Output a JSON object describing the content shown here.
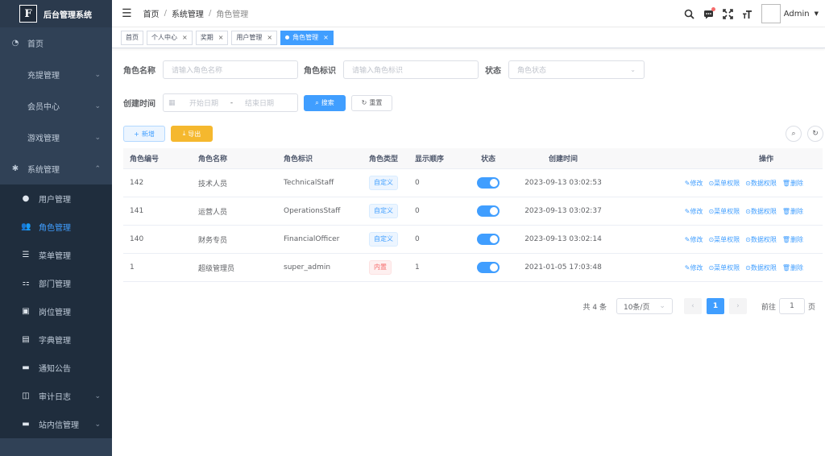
{
  "app": {
    "logo_letter": "F",
    "title": "后台管理系统"
  },
  "sidebar": {
    "items": [
      {
        "label": "首页",
        "icon": "dashboard-icon"
      },
      {
        "label": "充提管理"
      },
      {
        "label": "会员中心"
      },
      {
        "label": "游戏管理"
      },
      {
        "label": "系统管理",
        "icon": "gear-icon"
      }
    ],
    "submenu": [
      {
        "label": "用户管理",
        "icon": "user-icon"
      },
      {
        "label": "角色管理",
        "icon": "peoples-icon"
      },
      {
        "label": "菜单管理",
        "icon": "menu-list-icon"
      },
      {
        "label": "部门管理",
        "icon": "tree-icon"
      },
      {
        "label": "岗位管理",
        "icon": "post-icon"
      },
      {
        "label": "字典管理",
        "icon": "dict-icon"
      },
      {
        "label": "通知公告",
        "icon": "message-icon"
      },
      {
        "label": "审计日志",
        "icon": "log-icon"
      },
      {
        "label": "站内信管理",
        "icon": "mail-icon"
      }
    ]
  },
  "header": {
    "breadcrumb": [
      "首页",
      "系统管理",
      "角色管理"
    ],
    "user": "Admin"
  },
  "tags": [
    {
      "label": "首页"
    },
    {
      "label": "个人中心"
    },
    {
      "label": "奖期"
    },
    {
      "label": "用户管理"
    },
    {
      "label": "角色管理"
    }
  ],
  "search": {
    "role_name_label": "角色名称",
    "role_name_placeholder": "请输入角色名称",
    "role_key_label": "角色标识",
    "role_key_placeholder": "请输入角色标识",
    "status_label": "状态",
    "status_placeholder": "角色状态",
    "created_label": "创建时间",
    "start_placeholder": "开始日期",
    "range_sep": "-",
    "end_placeholder": "结束日期",
    "search_btn": "搜索",
    "reset_btn": "重置"
  },
  "toolbar": {
    "add_btn": "新增",
    "export_btn": "导出"
  },
  "table": {
    "headers": [
      "角色编号",
      "角色名称",
      "角色标识",
      "角色类型",
      "显示顺序",
      "状态",
      "创建时间",
      "操作"
    ],
    "rows": [
      {
        "id": "142",
        "name": "技术人员",
        "key": "TechnicalStaff",
        "type": "自定义",
        "order": "0",
        "created": "2023-09-13 03:02:53"
      },
      {
        "id": "141",
        "name": "运营人员",
        "key": "OperationsStaff",
        "type": "自定义",
        "order": "0",
        "created": "2023-09-13 03:02:37"
      },
      {
        "id": "140",
        "name": "财务专员",
        "key": "FinancialOfficer",
        "type": "自定义",
        "order": "0",
        "created": "2023-09-13 03:02:14"
      },
      {
        "id": "1",
        "name": "超级管理员",
        "key": "super_admin",
        "type": "内置",
        "order": "1",
        "created": "2021-01-05 17:03:48"
      }
    ],
    "ops": [
      "修改",
      "菜单权限",
      "数据权限",
      "删除"
    ]
  },
  "pagination": {
    "total": "共 4 条",
    "page_size": "10条/页",
    "current_page": "1",
    "goto_label": "前往",
    "goto_value": "1",
    "page_unit": "页"
  },
  "colors": {
    "primary": "#409eff",
    "sidebar": "#304156",
    "warning": "#f5b82e",
    "danger": "#f56c6c"
  }
}
